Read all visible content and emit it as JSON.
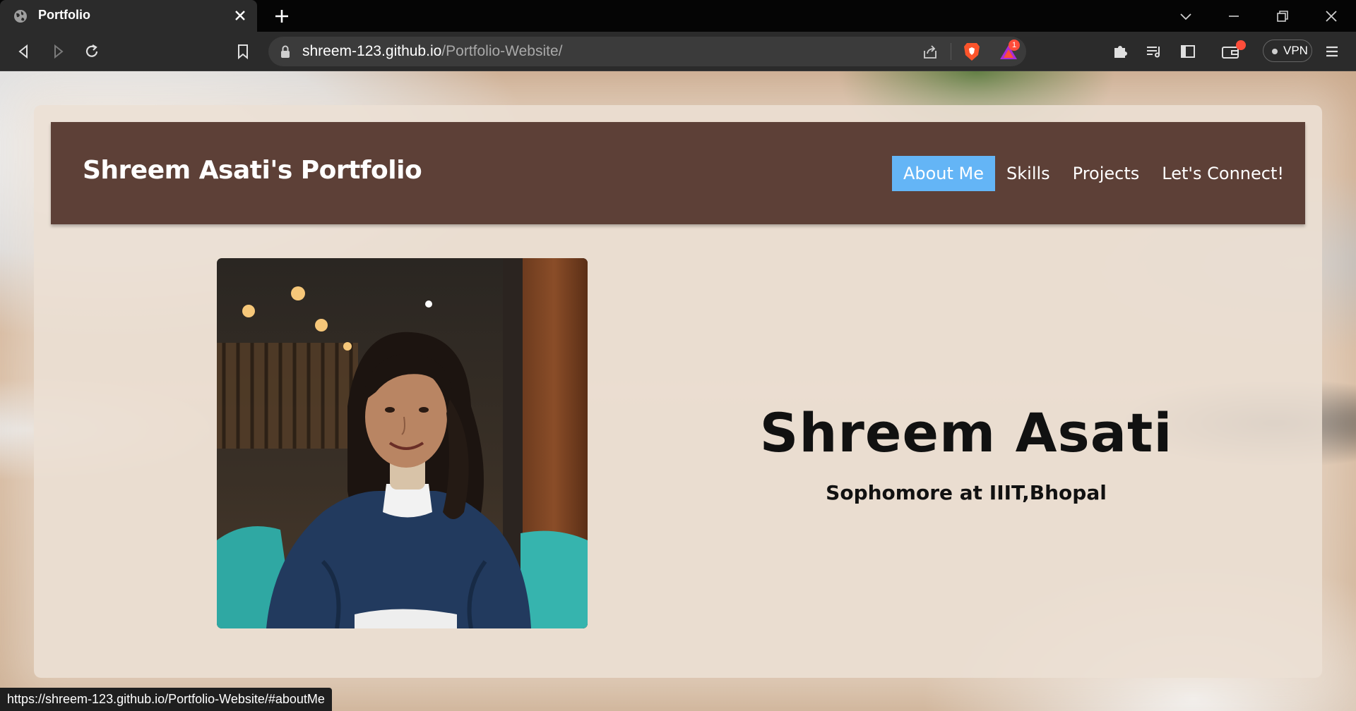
{
  "browser": {
    "tab": {
      "title": "Portfolio",
      "icon": "globe-icon"
    },
    "address": {
      "host": "shreem-123.github.io",
      "path": "/Portfolio-Website/"
    },
    "rewards_badge": "1",
    "vpn_label": "VPN",
    "status_url": "https://shreem-123.github.io/Portfolio-Website/#aboutMe"
  },
  "page": {
    "brand": "Shreem Asati's Portfolio",
    "nav": [
      {
        "label": "About Me",
        "active": true
      },
      {
        "label": "Skills",
        "active": false
      },
      {
        "label": "Projects",
        "active": false
      },
      {
        "label": "Let's Connect!",
        "active": false
      }
    ],
    "hero": {
      "name": "Shreem Asati",
      "subtitle": "Sophomore at IIIT,Bhopal"
    }
  },
  "colors": {
    "navbar": "#5d4037",
    "active_nav": "#64b5f6",
    "card": "#ece0d4"
  }
}
